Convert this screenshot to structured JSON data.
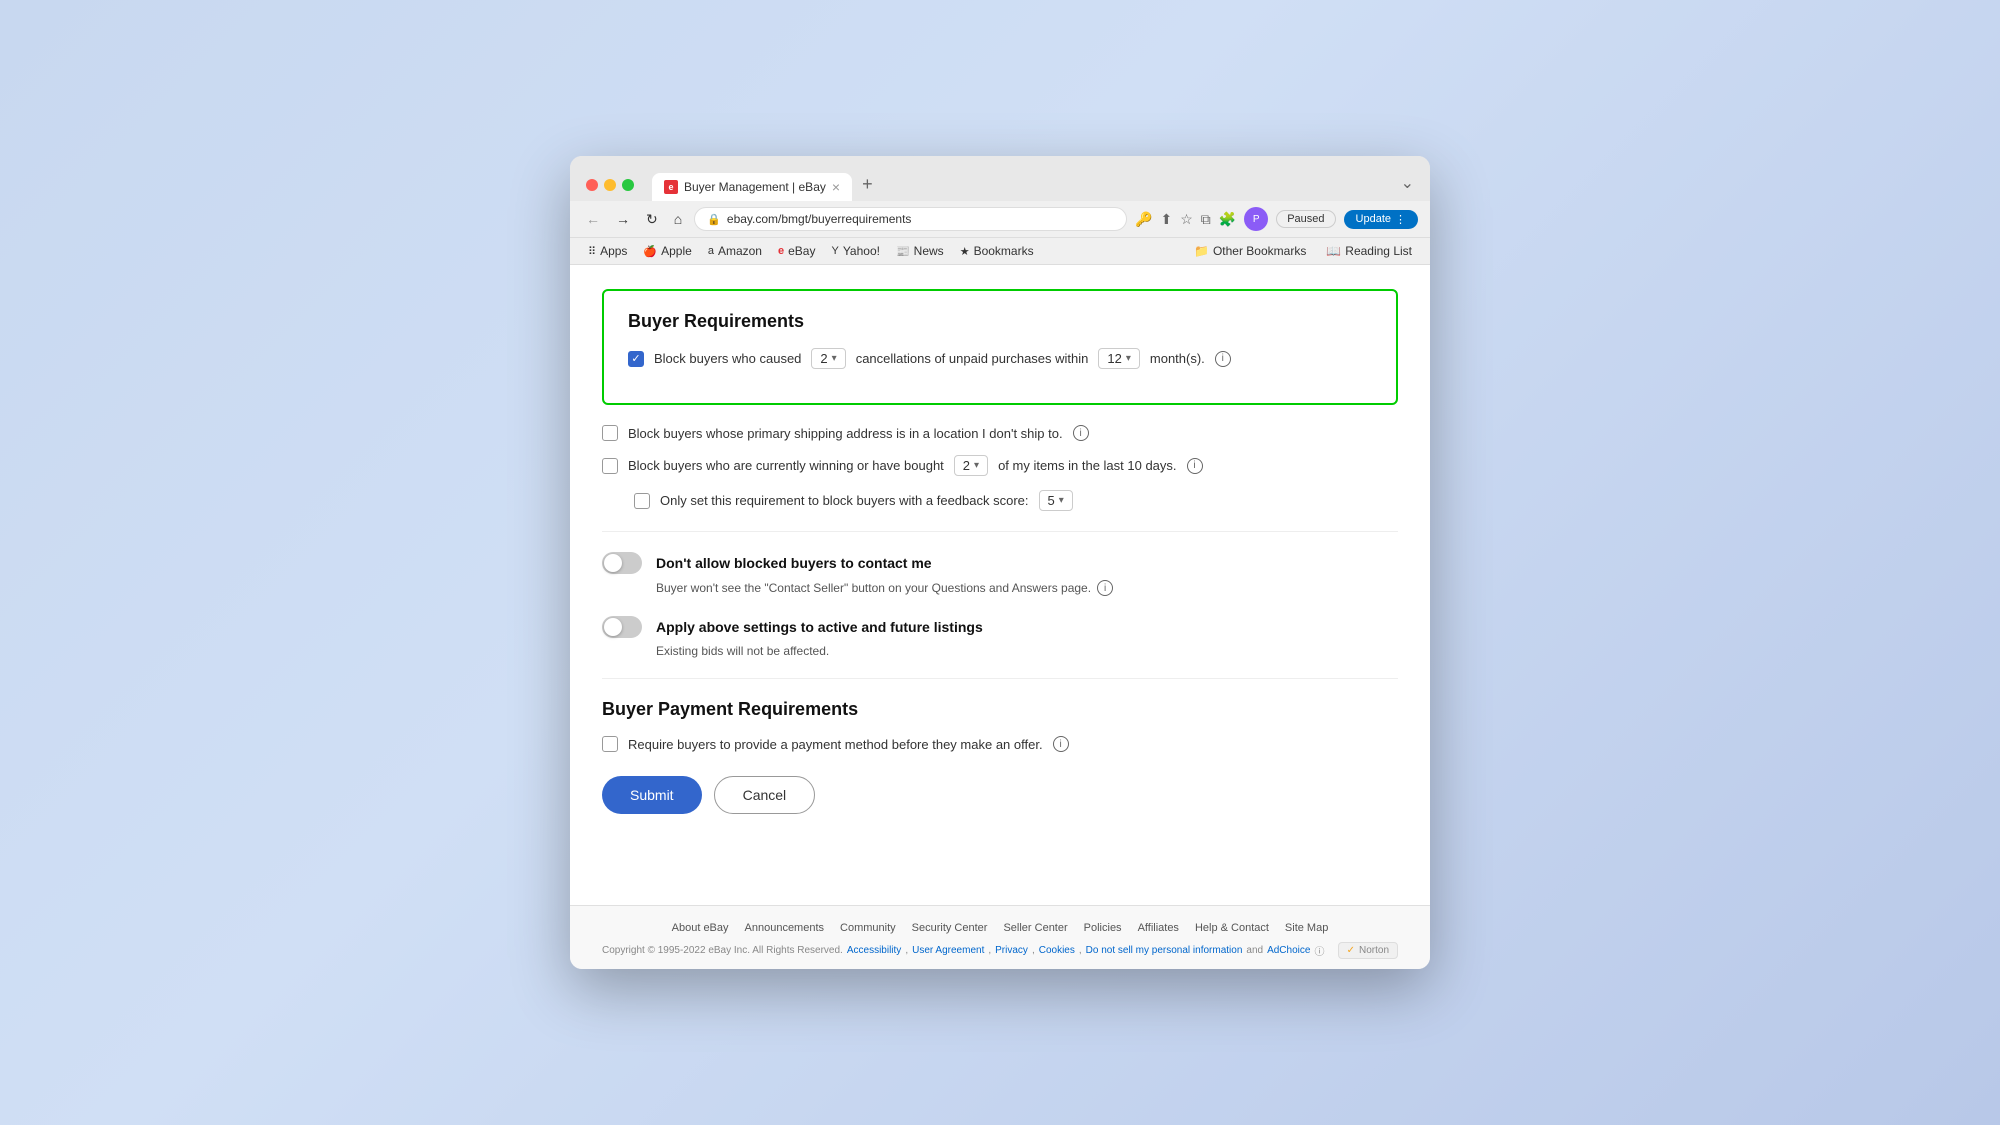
{
  "browser": {
    "tab_title": "Buyer Management | eBay",
    "url": "ebay.com/bmgt/buyerrequirements",
    "new_tab_icon": "+",
    "window_collapse": "⌄"
  },
  "bookmarks": {
    "apps_label": "Apps",
    "apple_label": "Apple",
    "amazon_label": "Amazon",
    "ebay_label": "eBay",
    "yahoo_label": "Yahoo!",
    "news_label": "News",
    "bookmarks_label": "Bookmarks",
    "other_bookmarks_label": "Other Bookmarks",
    "reading_list_label": "Reading List"
  },
  "nav": {
    "paused_label": "Paused",
    "update_label": "Update"
  },
  "buyer_requirements": {
    "title": "Buyer Requirements",
    "row1": {
      "label_start": "Block buyers who caused",
      "dropdown1_value": "2",
      "label_mid": "cancellations of unpaid purchases within",
      "dropdown2_value": "12",
      "label_end": "month(s)."
    },
    "row2": {
      "label": "Block buyers whose primary shipping address is in a location I don't ship to."
    },
    "row3": {
      "label_start": "Block buyers who are currently winning or have bought",
      "dropdown_value": "2",
      "label_end": "of my items in the last 10 days."
    },
    "row4": {
      "label_start": "Only set this requirement to block buyers with a feedback score:",
      "dropdown_value": "5"
    },
    "toggle1": {
      "label": "Don't allow blocked buyers to contact me",
      "sublabel": "Buyer won't see the \"Contact Seller\" button on your Questions and Answers page."
    },
    "toggle2": {
      "label": "Apply above settings to active and future listings",
      "sublabel": "Existing bids will not be affected."
    }
  },
  "payment_requirements": {
    "title": "Buyer Payment Requirements",
    "row1": {
      "label": "Require buyers to provide a payment method before they make an offer."
    }
  },
  "actions": {
    "submit_label": "Submit",
    "cancel_label": "Cancel"
  },
  "footer": {
    "links": [
      "About eBay",
      "Announcements",
      "Community",
      "Security Center",
      "Seller Center",
      "Policies",
      "Affiliates",
      "Help & Contact",
      "Site Map"
    ],
    "copyright": "Copyright © 1995-2022 eBay Inc. All Rights Reserved.",
    "legal_links": [
      "Accessibility",
      "User Agreement",
      "Privacy",
      "Cookies",
      "Do not sell my personal information",
      "AdChoice"
    ],
    "norton_label": "Norton"
  }
}
